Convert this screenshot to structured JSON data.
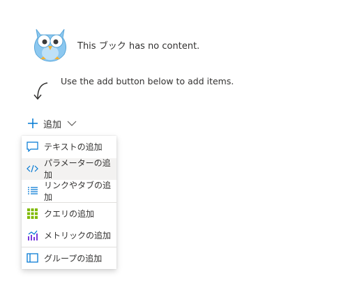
{
  "empty_state": {
    "message": "This ブック has no content.",
    "hint": "Use the add button below to add items."
  },
  "add_button": {
    "label": "追加",
    "icon": "plus-icon",
    "chevron": "chevron-down-icon"
  },
  "menu": {
    "items": [
      {
        "label": "テキストの追加",
        "icon": "text-comment-icon"
      },
      {
        "label": "パラメーターの追加",
        "icon": "code-icon"
      },
      {
        "label": "リンクやタブの追加",
        "icon": "bulleted-list-icon"
      },
      {
        "label": "クエリの追加",
        "icon": "grid-icon"
      },
      {
        "label": "メトリックの追加",
        "icon": "metrics-chart-icon"
      },
      {
        "label": "グループの追加",
        "icon": "group-panel-icon"
      }
    ],
    "highlighted_index": 1
  },
  "colors": {
    "accent": "#0078d4",
    "grid_green": "#7fba00",
    "metric_purple": "#773adc",
    "owl_body": "#8cc8f0"
  }
}
